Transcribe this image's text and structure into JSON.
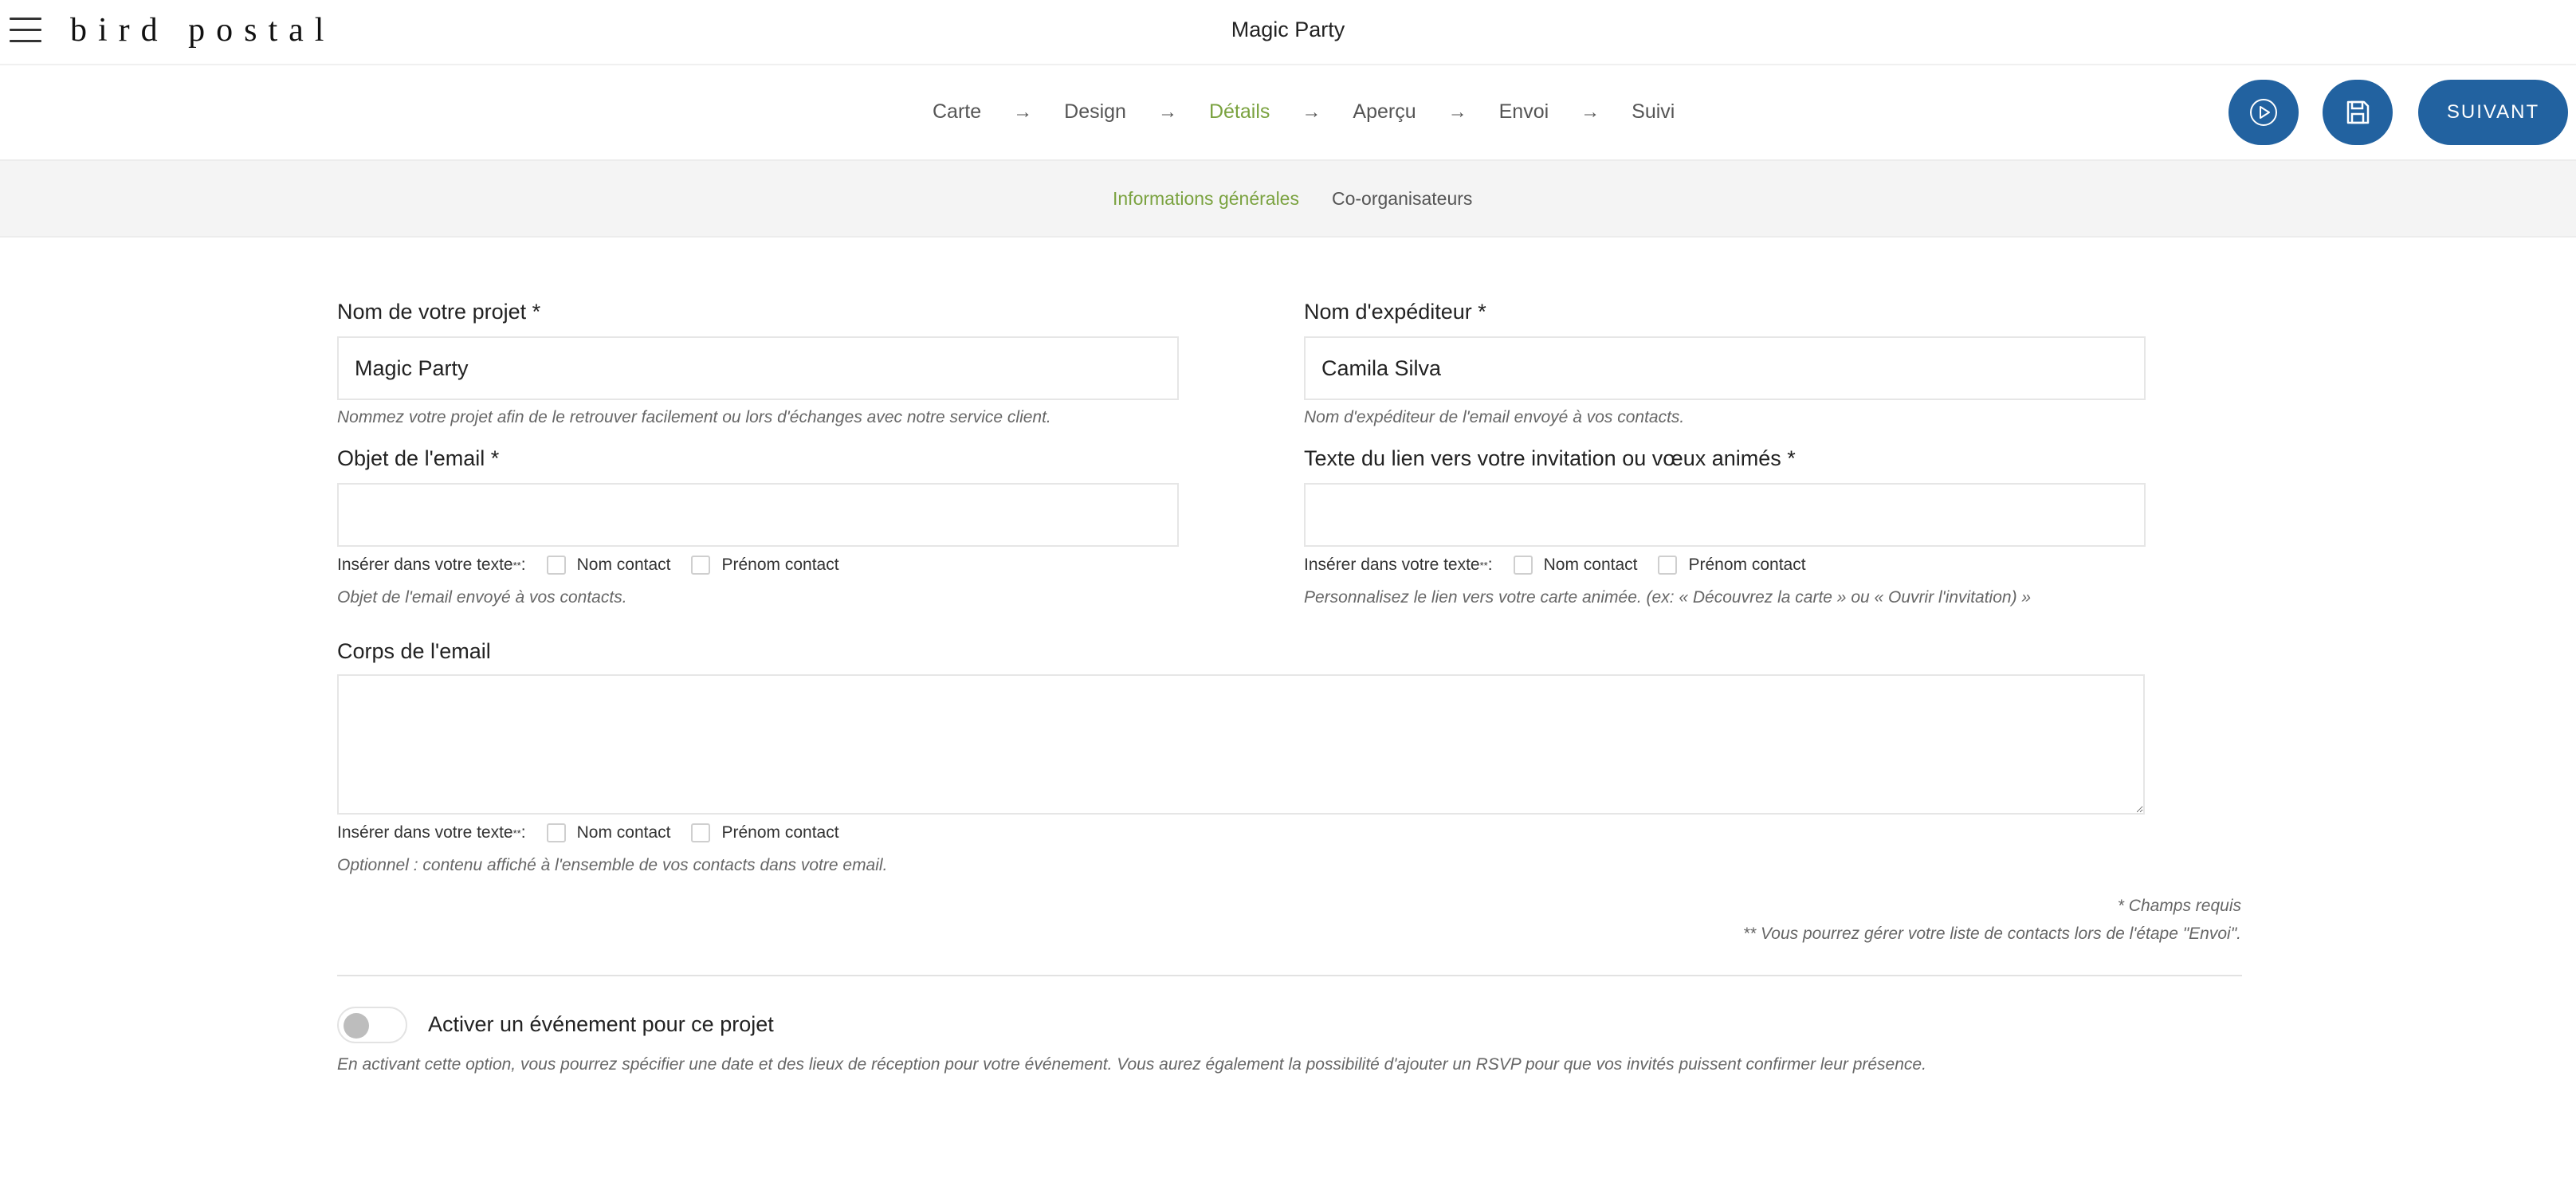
{
  "header": {
    "logo": "bird postal",
    "title": "Magic Party"
  },
  "steps": [
    {
      "label": "Carte"
    },
    {
      "label": "Design"
    },
    {
      "label": "Détails"
    },
    {
      "label": "Aperçu"
    },
    {
      "label": "Envoi"
    },
    {
      "label": "Suivi"
    }
  ],
  "active_step": "Détails",
  "arrow_glyph": "→",
  "actions": {
    "preview_icon": "play-circle-icon",
    "save_icon": "floppy-disk-icon",
    "next_label": "SUIVANT"
  },
  "subtabs": {
    "general": "Informations générales",
    "coorganizers": "Co-organisateurs",
    "active": "Informations générales"
  },
  "form": {
    "project_name": {
      "label": "Nom de votre projet *",
      "value": "Magic Party",
      "help": "Nommez votre projet afin de le retrouver facilement ou lors d'échanges avec notre service client."
    },
    "sender_name": {
      "label": "Nom d'expéditeur *",
      "value": "Camila Silva",
      "help": "Nom d'expéditeur de l'email envoyé à vos contacts."
    },
    "email_subject": {
      "label": "Objet de l'email *",
      "value": "",
      "help": "Objet de l'email envoyé à vos contacts."
    },
    "link_text": {
      "label": "Texte du lien vers votre invitation ou vœux animés *",
      "value": "",
      "help": "Personnalisez le lien vers votre carte animée. (ex: « Découvrez la carte » ou « Ouvrir l'invitation) »"
    },
    "email_body": {
      "label": "Corps de l'email",
      "value": "",
      "help": "Optionnel : contenu affiché à l'ensemble de vos contacts dans votre email."
    },
    "insert": {
      "label": "Insérer dans votre texte",
      "marker": "**",
      "colon": " :",
      "last_name": "Nom contact",
      "first_name": "Prénom contact"
    }
  },
  "notes": {
    "required": "* Champs requis",
    "contacts": "** Vous pourrez gérer votre liste de contacts lors de l'étape \"Envoi\"."
  },
  "event": {
    "toggle_label": "Activer un événement pour ce projet",
    "toggle_on": false,
    "help": "En activant cette option, vous pourrez spécifier une date et des lieux de réception pour votre événement. Vous aurez également la possibilité d'ajouter un RSVP pour que vos invités puissent confirmer leur présence."
  },
  "colors": {
    "accent_green": "#7aa23f",
    "primary_blue": "#2262a0"
  }
}
